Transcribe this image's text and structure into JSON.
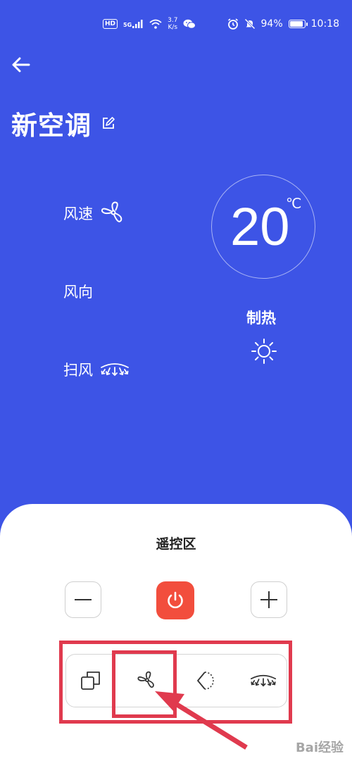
{
  "status_bar": {
    "network_badge": "HD",
    "signal_label": "5G",
    "speed_value": "3.7",
    "speed_unit": "K/s",
    "battery_percent": "94%",
    "battery_level": 0.94,
    "time": "10:18"
  },
  "header": {
    "title": "新空调"
  },
  "controls_info": {
    "fan_speed_label": "风速",
    "fan_direction_label": "风向",
    "swing_label": "扫风"
  },
  "temperature": {
    "value": "20",
    "unit": "℃"
  },
  "mode": {
    "label": "制热",
    "icon": "sun-icon"
  },
  "remote_panel": {
    "title": "遥控区",
    "minus_icon": "minus-icon",
    "power_icon": "power-icon",
    "plus_icon": "plus-icon",
    "functions": [
      "mode-icon",
      "fan-icon",
      "direction-icon",
      "swing-icon"
    ]
  },
  "watermark": "Bai经验",
  "colors": {
    "background": "#3d54e6",
    "power": "#f24e3d",
    "annotation": "#e03a4e"
  }
}
